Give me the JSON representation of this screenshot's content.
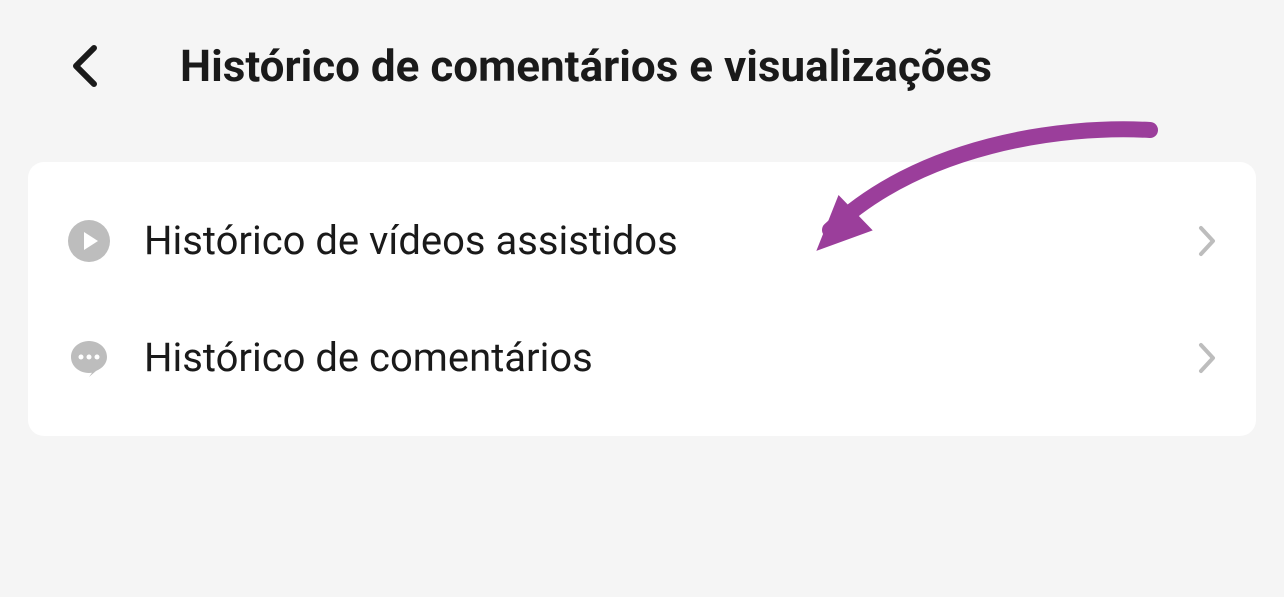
{
  "header": {
    "title": "Histórico de comentários e visualizações"
  },
  "items": [
    {
      "icon": "play",
      "label": "Histórico de vídeos assistidos"
    },
    {
      "icon": "comment",
      "label": "Histórico de comentários"
    }
  ],
  "colors": {
    "arrow": "#9b3e9b"
  }
}
